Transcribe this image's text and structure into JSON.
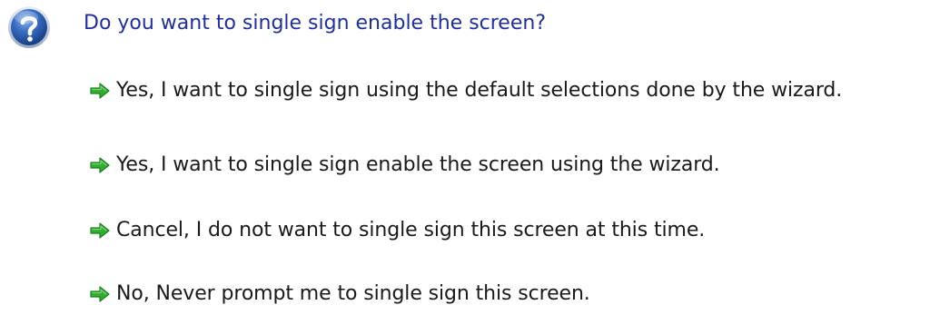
{
  "dialog": {
    "question": "Do you want to single sign enable the screen?",
    "icon": "question-icon",
    "options": [
      {
        "label": "Yes, I want to single sign using the default selections done by the wizard.",
        "icon": "green-arrow-icon"
      },
      {
        "label": "Yes, I want to single sign enable the screen using the wizard.",
        "icon": "green-arrow-icon"
      },
      {
        "label": "Cancel, I do not want to single sign this screen at this time.",
        "icon": "green-arrow-icon"
      },
      {
        "label": "No, Never prompt me to single sign this screen.",
        "icon": "green-arrow-icon"
      }
    ]
  },
  "colors": {
    "question_text": "#1f2f9f",
    "option_text": "#1a1a1a",
    "arrow": "#2fae2f",
    "icon_blue": "#1c4fa8"
  }
}
